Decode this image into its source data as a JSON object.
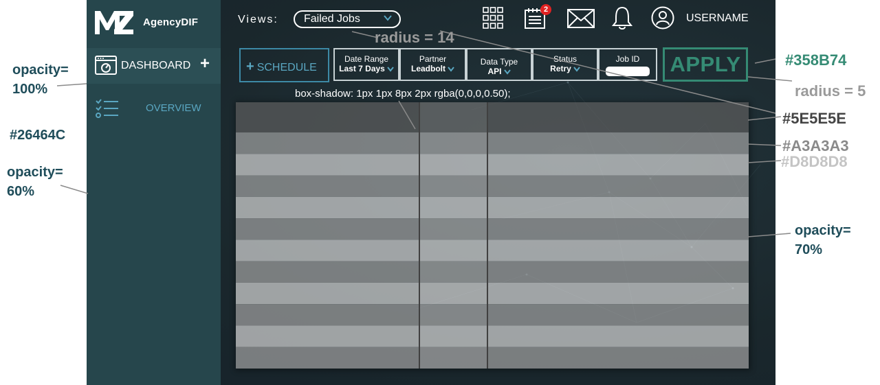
{
  "app": {
    "brand": "AgencyDIF",
    "sidebar": {
      "dashboard_label": "DASHBOARD",
      "dashboard_plus": "+",
      "overview_label": "OVERVIEW"
    },
    "topbar": {
      "views_label": "Views:",
      "views_value": "Failed Jobs",
      "notification_count": "2",
      "username": "USERNAME"
    },
    "filters": {
      "schedule_label": "SCHEDULE",
      "schedule_plus": "+",
      "date_range": {
        "title": "Date Range",
        "value": "Last 7 Days"
      },
      "partner": {
        "title": "Partner",
        "value": "Leadbolt"
      },
      "data_type": {
        "title": "Data Type",
        "value": "API"
      },
      "status": {
        "title": "Status",
        "value": "Retry"
      },
      "job_id": {
        "title": "Job ID",
        "value": ""
      },
      "apply_label": "APPLY"
    },
    "table": {
      "shadow_caption": "box-shadow: 1px 1px 8px 2px rgba(0,0,0,0.50);",
      "header_color": "#5E5E5E",
      "row_colors": [
        "#A3A3A3",
        "#D8D8D8"
      ],
      "row_count": 11
    }
  },
  "annotations": {
    "opacity_100": "opacity=\n100%",
    "sidebar_color": "#26464C",
    "opacity_60": "opacity=\n60%",
    "radius_14": "radius = 14",
    "green_color": "#358B74",
    "radius_5": "radius = 5",
    "gray_5e": "#5E5E5E",
    "gray_a3": "#A3A3A3",
    "gray_d8": "#D8D8D8",
    "opacity_70": "opacity=\n70%"
  },
  "colors": {
    "sidebar": "#26464C",
    "accent_green": "#358B74",
    "accent_blue": "#5aa7c2"
  }
}
